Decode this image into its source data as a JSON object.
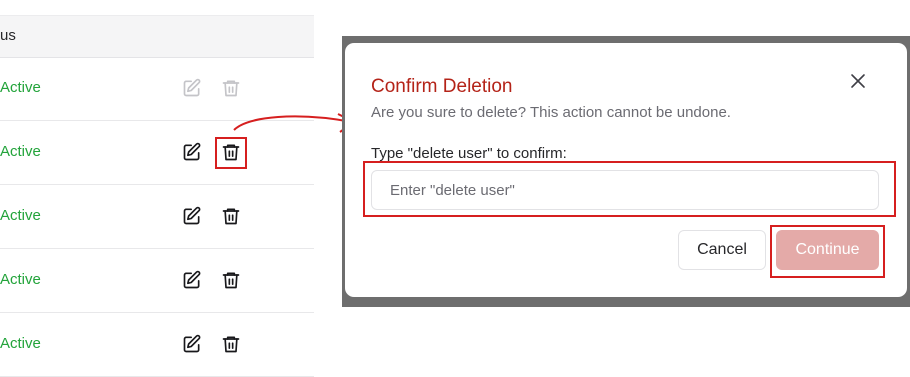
{
  "table": {
    "header_status": "us",
    "rows": [
      {
        "status": "Active",
        "actions_enabled": false
      },
      {
        "status": "Active",
        "actions_enabled": true
      },
      {
        "status": "Active",
        "actions_enabled": true
      },
      {
        "status": "Active",
        "actions_enabled": true
      },
      {
        "status": "Active",
        "actions_enabled": true
      }
    ],
    "icons": {
      "edit": "edit-icon",
      "delete": "trash-icon"
    }
  },
  "dialog": {
    "title": "Confirm Deletion",
    "description": "Are you sure to delete? This action cannot be undone.",
    "close_icon": "close-icon",
    "input_label": "Type \"delete user\" to confirm:",
    "input_placeholder": "Enter \"delete user\"",
    "input_value": "",
    "cancel_label": "Cancel",
    "continue_label": "Continue"
  },
  "colors": {
    "status_active": "#22a33a",
    "title": "#b42318",
    "continue_disabled_bg": "#e4aaa8",
    "annotation": "#d61f1f"
  }
}
